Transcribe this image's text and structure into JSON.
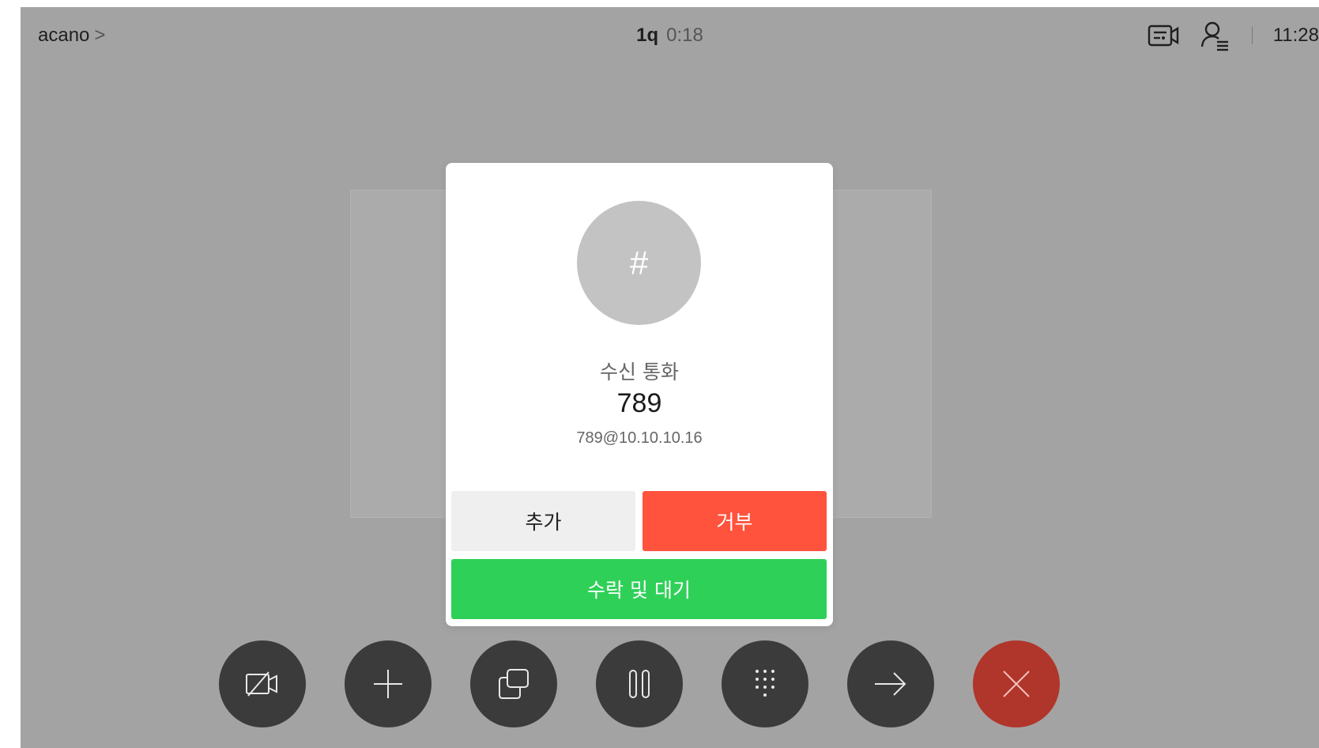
{
  "topbar": {
    "breadcrumb": "acano",
    "breadcrumb_chevron": ">",
    "call_name": "1q",
    "call_timer": "0:18",
    "clock": "11:28",
    "icons": [
      "self-view-icon",
      "participants-icon"
    ]
  },
  "dialog": {
    "avatar_glyph": "#",
    "label": "수신 통화",
    "number": "789",
    "address": "789@10.10.10.16",
    "add_button": "추가",
    "decline_button": "거부",
    "accept_button": "수락 및 대기"
  },
  "callbar": {
    "buttons": [
      "camera-off-icon",
      "add-icon",
      "share-icon",
      "hold-icon",
      "keypad-icon",
      "transfer-icon",
      "end-call-icon"
    ]
  },
  "colors": {
    "background": "#a3a3a3",
    "decline": "#ff533e",
    "accept": "#2fd058",
    "end_call": "#b0352b",
    "callbar_button": "#3b3b3b"
  }
}
